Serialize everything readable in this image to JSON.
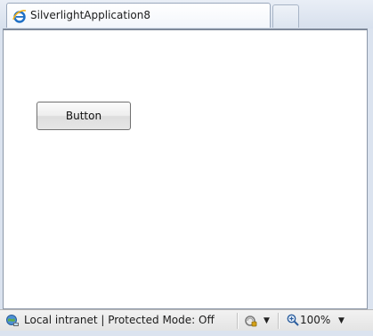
{
  "tab": {
    "title": "SilverlightApplication8",
    "icon": "internet-explorer-icon"
  },
  "content": {
    "button_label": "Button"
  },
  "statusbar": {
    "zone_text": "Local intranet | Protected Mode: Off",
    "zone_icon": "intranet-globe-icon",
    "security_icon": "security-lock-icon",
    "zoom_icon": "zoom-magnifier-icon",
    "zoom_text": "100%",
    "dropdown_glyph": "▼"
  },
  "colors": {
    "tab_strip": "#dbe3ef",
    "ie_blue": "#1f6fc5",
    "content_bg": "#ffffff"
  }
}
